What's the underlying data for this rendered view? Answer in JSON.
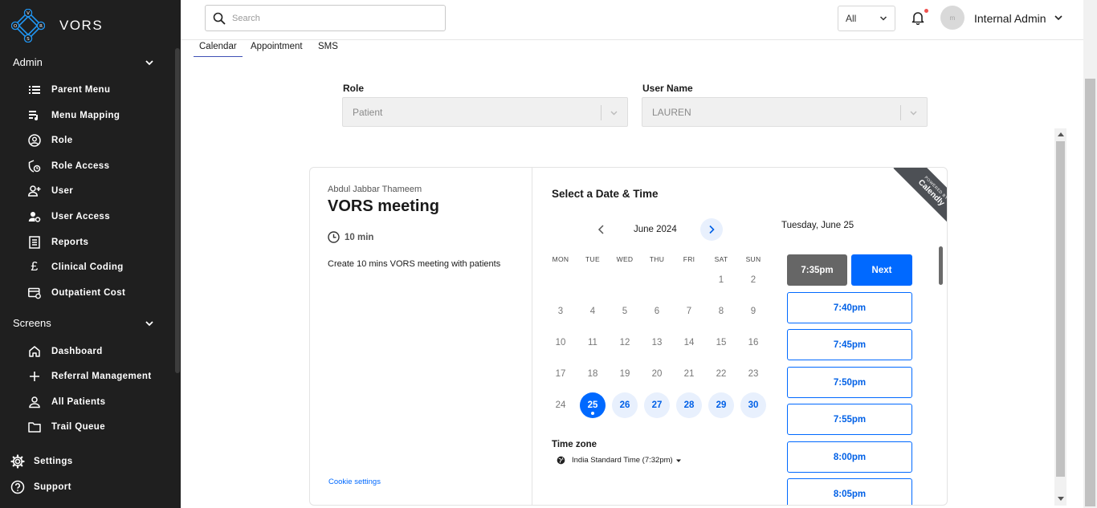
{
  "app": {
    "name": "VORS",
    "logo_letters": [
      "V",
      "O",
      "R",
      "S"
    ]
  },
  "sidebar": {
    "sections": [
      {
        "label": "Admin",
        "items": [
          {
            "label": "Parent Menu",
            "icon": "list-icon"
          },
          {
            "label": "Menu Mapping",
            "icon": "playlist-icon"
          },
          {
            "label": "Role",
            "icon": "account-circle-icon"
          },
          {
            "label": "Role Access",
            "icon": "shield-lock-icon"
          },
          {
            "label": "User",
            "icon": "person-add-icon"
          },
          {
            "label": "User Access",
            "icon": "person-settings-icon"
          },
          {
            "label": "Reports",
            "icon": "report-icon"
          },
          {
            "label": "Clinical Coding",
            "icon": "pound-icon"
          },
          {
            "label": "Outpatient Cost",
            "icon": "card-settings-icon"
          }
        ]
      },
      {
        "label": "Screens",
        "items": [
          {
            "label": "Dashboard",
            "icon": "home-icon"
          },
          {
            "label": "Referral Management",
            "icon": "plus-icon"
          },
          {
            "label": "All Patients",
            "icon": "person-icon"
          },
          {
            "label": "Trail Queue",
            "icon": "folder-icon"
          }
        ]
      }
    ],
    "bottom": [
      {
        "label": "Settings",
        "icon": "gear-icon"
      },
      {
        "label": "Support",
        "icon": "help-icon"
      }
    ]
  },
  "topbar": {
    "search_placeholder": "Search",
    "filter_value": "All",
    "avatar_initial": "m",
    "user_name": "Internal Admin"
  },
  "tabs": [
    {
      "label": "Calendar",
      "active": true
    },
    {
      "label": "Appointment",
      "active": false
    },
    {
      "label": "SMS",
      "active": false
    }
  ],
  "form": {
    "role_label": "Role",
    "role_value": "Patient",
    "username_label": "User Name",
    "username_value": "LAUREN"
  },
  "booking": {
    "host": "Abdul Jabbar Thameem",
    "event_title": "VORS meeting",
    "duration": "10 min",
    "description": "Create 10 mins VORS meeting with patients",
    "cookie_link": "Cookie settings",
    "select_title": "Select a Date & Time",
    "month": "June 2024",
    "weekdays": [
      "MON",
      "TUE",
      "WED",
      "THU",
      "FRI",
      "SAT",
      "SUN"
    ],
    "weeks": [
      [
        "",
        "",
        "",
        "",
        "",
        "1",
        "2"
      ],
      [
        "3",
        "4",
        "5",
        "6",
        "7",
        "8",
        "9"
      ],
      [
        "10",
        "11",
        "12",
        "13",
        "14",
        "15",
        "16"
      ],
      [
        "17",
        "18",
        "19",
        "20",
        "21",
        "22",
        "23"
      ],
      [
        "24",
        "25",
        "26",
        "27",
        "28",
        "29",
        "30"
      ]
    ],
    "selected_day": "25",
    "available_days": [
      "26",
      "27",
      "28",
      "29",
      "30"
    ],
    "timezone_label": "Time zone",
    "timezone_value": "India Standard Time (7:32pm)",
    "selected_date_label": "Tuesday, June 25",
    "selected_slot": "7:35pm",
    "next_label": "Next",
    "slots": [
      "7:40pm",
      "7:45pm",
      "7:50pm",
      "7:55pm",
      "8:00pm",
      "8:05pm"
    ],
    "ribbon_top": "POWERED BY",
    "ribbon_brand": "Calendly"
  },
  "colors": {
    "sidebar_bg": "#1f1f1f",
    "accent": "#0069ff",
    "logo_blue": "#2196f3"
  }
}
